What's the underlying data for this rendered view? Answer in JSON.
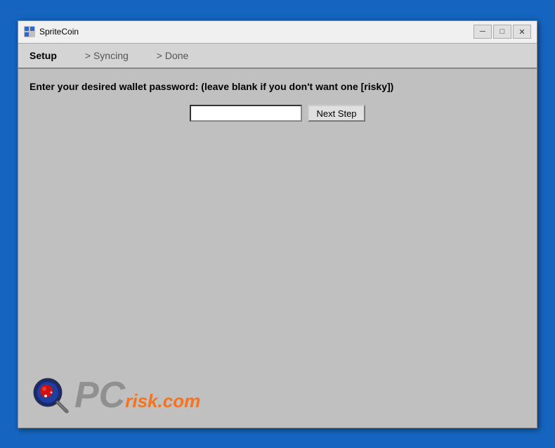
{
  "window": {
    "title": "SpriteCoin",
    "icon_name": "spritecoin-icon"
  },
  "titlebar": {
    "minimize_label": "─",
    "maximize_label": "□",
    "close_label": "✕"
  },
  "navbar": {
    "items": [
      {
        "label": "Setup",
        "state": "active"
      },
      {
        "label": "> Syncing",
        "state": "inactive"
      },
      {
        "label": "> Done",
        "state": "inactive"
      }
    ]
  },
  "content": {
    "prompt": "Enter your desired wallet password: (leave blank if you don't want one [risky])",
    "password_placeholder": "",
    "next_step_label": "Next Step"
  },
  "watermark": {
    "pc_text": "PC",
    "risk_text": "risk",
    "dot_com_text": ".com"
  }
}
